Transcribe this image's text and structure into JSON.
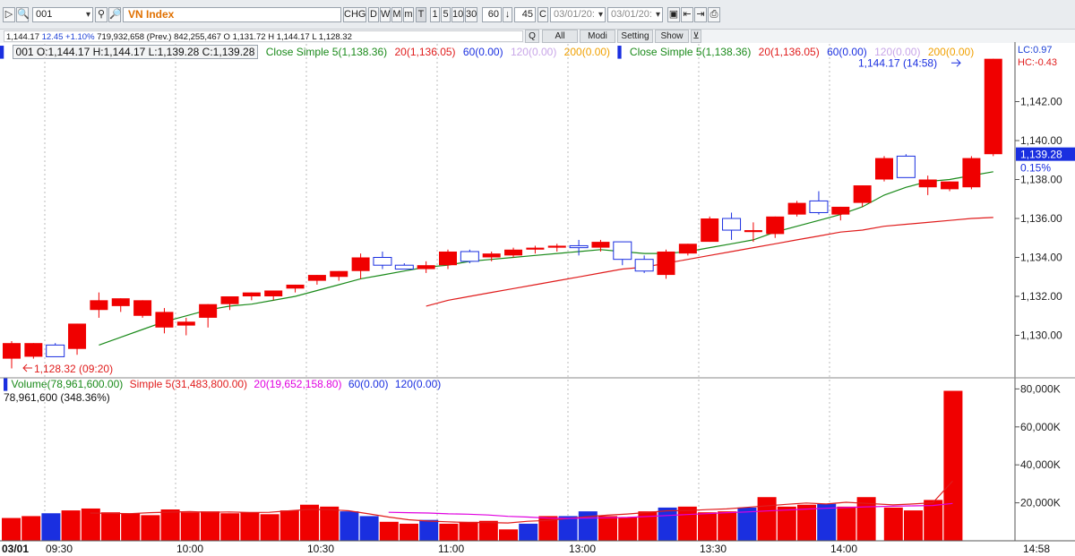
{
  "toolbar": {
    "code_value": "001",
    "index_name": "VN Index",
    "buttons": [
      "CHG",
      "D",
      "W",
      "M",
      "m",
      "T",
      "1",
      "5",
      "10",
      "30"
    ],
    "interval_value": "60",
    "step_value": "45",
    "c_label": "C",
    "date_from": "03/01/20:",
    "date_to": "03/01/20:"
  },
  "infobar": {
    "price": "1,144.17",
    "change": "12.45",
    "change_pct": "+1.10%",
    "rest": "719,932,658 (Prev.) 842,255,467 O 1,131.72 H 1,144.17 L 1,128.32",
    "q_label": "Q",
    "all_label": "All",
    "modi_label": "Modi",
    "setting_label": "Setting",
    "show_label": "Show"
  },
  "legend": {
    "ohlc": "001 O:1,144.17 H:1,144.17 L:1,139.28 C:1,139.28",
    "ma5": "Close Simple 5(1,138.36)",
    "ma20": "20(1,136.05)",
    "ma60": "60(0.00)",
    "ma120": "120(0.00)",
    "ma200": "200(0.00)",
    "ma5_b": "Close Simple 5(1,138.36)",
    "ma20_b": "20(1,136.05)",
    "ma60_b": "60(0.00)",
    "ma120_b": "120(0.00)",
    "ma200_b": "200(0.00)",
    "lc": "LC:0.97",
    "hc": "HC:-0.43"
  },
  "vlegend": {
    "volume": "Volume(78,961,600.00)",
    "ma5": "Simple 5(31,483,800.00)",
    "ma20": "20(19,652,158.80)",
    "ma60": "60(0.00)",
    "ma120": "120(0.00)",
    "sub": "78,961,600 (348.36%)"
  },
  "price_axis": {
    "ticks": [
      "1,142.00",
      "1,140.00",
      "1,138.00",
      "1,136.00",
      "1,134.00",
      "1,132.00",
      "1,130.00"
    ],
    "current": "1,139.28",
    "current_pct": "0.15%"
  },
  "volume_axis": {
    "ticks": [
      "80,000K",
      "60,000K",
      "40,000K",
      "20,000K"
    ]
  },
  "time_axis": {
    "date": "03/01",
    "labels": [
      "09:30",
      "10:00",
      "10:30",
      "11:00",
      "13:00",
      "13:30",
      "14:00"
    ],
    "last": "14:58"
  },
  "annotations": {
    "high": "1,144.17 (14:58)",
    "low": "1,128.32 (09:20)"
  },
  "colors": {
    "up": "#f00000",
    "down": "#1a2fe0",
    "ma5": "#1a8a1a",
    "ma20": "#e01c1c",
    "vol_ma5": "#e01c1c",
    "vol_ma20": "#e000e0"
  },
  "chart_data": {
    "type": "candlestick",
    "price_range": [
      1128.3,
      1144.2
    ],
    "volume_range_k": [
      0,
      80000
    ],
    "candles": [
      {
        "o": 1128.8,
        "h": 1129.7,
        "l": 1128.3,
        "c": 1129.6
      },
      {
        "o": 1128.9,
        "h": 1129.6,
        "l": 1128.8,
        "c": 1129.6
      },
      {
        "o": 1129.5,
        "h": 1129.6,
        "l": 1128.9,
        "c": 1128.9
      },
      {
        "o": 1129.3,
        "h": 1130.6,
        "l": 1129.0,
        "c": 1130.6
      },
      {
        "o": 1131.3,
        "h": 1132.2,
        "l": 1130.9,
        "c": 1131.8
      },
      {
        "o": 1131.5,
        "h": 1131.9,
        "l": 1131.2,
        "c": 1131.9
      },
      {
        "o": 1131.0,
        "h": 1131.8,
        "l": 1130.9,
        "c": 1131.8
      },
      {
        "o": 1130.4,
        "h": 1131.4,
        "l": 1130.1,
        "c": 1131.2
      },
      {
        "o": 1130.5,
        "h": 1130.9,
        "l": 1130.0,
        "c": 1130.7
      },
      {
        "o": 1130.9,
        "h": 1131.6,
        "l": 1130.4,
        "c": 1131.6
      },
      {
        "o": 1131.6,
        "h": 1132.0,
        "l": 1131.3,
        "c": 1132.0
      },
      {
        "o": 1132.0,
        "h": 1132.2,
        "l": 1131.8,
        "c": 1132.2
      },
      {
        "o": 1132.0,
        "h": 1132.3,
        "l": 1131.8,
        "c": 1132.3
      },
      {
        "o": 1132.4,
        "h": 1132.6,
        "l": 1132.2,
        "c": 1132.6
      },
      {
        "o": 1132.8,
        "h": 1133.1,
        "l": 1132.6,
        "c": 1133.1
      },
      {
        "o": 1133.0,
        "h": 1133.3,
        "l": 1132.8,
        "c": 1133.3
      },
      {
        "o": 1133.3,
        "h": 1134.2,
        "l": 1132.9,
        "c": 1134.0
      },
      {
        "o": 1134.0,
        "h": 1134.3,
        "l": 1133.4,
        "c": 1133.6
      },
      {
        "o": 1133.6,
        "h": 1133.7,
        "l": 1133.4,
        "c": 1133.4
      },
      {
        "o": 1133.4,
        "h": 1133.8,
        "l": 1133.2,
        "c": 1133.6
      },
      {
        "o": 1133.6,
        "h": 1134.4,
        "l": 1133.4,
        "c": 1134.3
      },
      {
        "o": 1134.3,
        "h": 1134.4,
        "l": 1133.7,
        "c": 1133.8
      },
      {
        "o": 1134.0,
        "h": 1134.3,
        "l": 1133.8,
        "c": 1134.2
      },
      {
        "o": 1134.1,
        "h": 1134.5,
        "l": 1134.0,
        "c": 1134.4
      },
      {
        "o": 1134.4,
        "h": 1134.6,
        "l": 1134.2,
        "c": 1134.5
      },
      {
        "o": 1134.5,
        "h": 1134.7,
        "l": 1134.3,
        "c": 1134.6
      },
      {
        "o": 1134.6,
        "h": 1134.9,
        "l": 1134.1,
        "c": 1134.5
      },
      {
        "o": 1134.5,
        "h": 1134.9,
        "l": 1134.3,
        "c": 1134.8
      },
      {
        "o": 1134.8,
        "h": 1134.8,
        "l": 1133.6,
        "c": 1133.9
      },
      {
        "o": 1133.9,
        "h": 1134.1,
        "l": 1133.2,
        "c": 1133.3
      },
      {
        "o": 1133.1,
        "h": 1134.4,
        "l": 1132.9,
        "c": 1134.3
      },
      {
        "o": 1134.2,
        "h": 1134.7,
        "l": 1134.1,
        "c": 1134.7
      },
      {
        "o": 1134.8,
        "h": 1136.1,
        "l": 1134.8,
        "c": 1136.0
      },
      {
        "o": 1136.0,
        "h": 1136.3,
        "l": 1134.9,
        "c": 1135.4
      },
      {
        "o": 1135.3,
        "h": 1135.8,
        "l": 1134.8,
        "c": 1135.4
      },
      {
        "o": 1135.2,
        "h": 1136.1,
        "l": 1135.0,
        "c": 1136.1
      },
      {
        "o": 1136.2,
        "h": 1136.9,
        "l": 1136.1,
        "c": 1136.8
      },
      {
        "o": 1136.9,
        "h": 1137.4,
        "l": 1136.2,
        "c": 1136.3
      },
      {
        "o": 1136.2,
        "h": 1136.6,
        "l": 1135.9,
        "c": 1136.6
      },
      {
        "o": 1136.8,
        "h": 1137.7,
        "l": 1136.6,
        "c": 1137.7
      },
      {
        "o": 1138.0,
        "h": 1139.2,
        "l": 1137.9,
        "c": 1139.1
      },
      {
        "o": 1139.2,
        "h": 1139.3,
        "l": 1138.1,
        "c": 1138.1
      },
      {
        "o": 1137.6,
        "h": 1138.2,
        "l": 1137.2,
        "c": 1138.0
      },
      {
        "o": 1137.5,
        "h": 1137.9,
        "l": 1137.4,
        "c": 1137.9
      },
      {
        "o": 1137.6,
        "h": 1139.2,
        "l": 1137.5,
        "c": 1139.1
      },
      {
        "o": 1139.3,
        "h": 1144.2,
        "l": 1139.2,
        "c": 1144.2
      }
    ],
    "ma5": [
      null,
      null,
      null,
      null,
      1129.5,
      1129.9,
      1130.3,
      1130.7,
      1131.0,
      1131.3,
      1131.5,
      1131.6,
      1131.8,
      1132.0,
      1132.3,
      1132.6,
      1132.9,
      1133.1,
      1133.3,
      1133.5,
      1133.6,
      1133.8,
      1133.9,
      1134.0,
      1134.1,
      1134.2,
      1134.3,
      1134.4,
      1134.3,
      1134.2,
      1134.2,
      1134.3,
      1134.5,
      1134.7,
      1134.9,
      1135.3,
      1135.6,
      1135.9,
      1136.2,
      1136.6,
      1137.2,
      1137.6,
      1137.9,
      1138.0,
      1138.2,
      1138.4
    ],
    "ma20": [
      null,
      null,
      null,
      null,
      null,
      null,
      null,
      null,
      null,
      null,
      null,
      null,
      null,
      null,
      null,
      null,
      null,
      null,
      null,
      1131.5,
      1131.8,
      1132.0,
      1132.2,
      1132.4,
      1132.6,
      1132.8,
      1133.0,
      1133.2,
      1133.4,
      1133.5,
      1133.7,
      1133.9,
      1134.1,
      1134.3,
      1134.5,
      1134.7,
      1134.9,
      1135.1,
      1135.3,
      1135.4,
      1135.6,
      1135.7,
      1135.8,
      1135.9,
      1136.0,
      1136.05
    ],
    "volume_k": [
      12000,
      13000,
      14500,
      16000,
      17000,
      15000,
      14500,
      13500,
      16500,
      15000,
      15500,
      14500,
      15000,
      14000,
      16000,
      19000,
      18000,
      15500,
      13000,
      10000,
      9000,
      11000,
      9000,
      10000,
      10500,
      6000,
      9000,
      13000,
      13000,
      15500,
      13000,
      12500,
      15500,
      17500,
      18000,
      15000,
      15500,
      17500,
      23000,
      18000,
      19000,
      19500,
      18000,
      23000,
      17500,
      16000,
      21500,
      79000
    ],
    "vol_ma5": [
      null,
      null,
      null,
      null,
      14600,
      14500,
      14300,
      14800,
      15100,
      15400,
      15000,
      15200,
      14900,
      15000,
      15800,
      16500,
      16400,
      15800,
      14200,
      12500,
      11100,
      10400,
      10000,
      9600,
      9600,
      9400,
      10300,
      10700,
      11700,
      12700,
      13500,
      14100,
      14900,
      15800,
      15900,
      16400,
      16800,
      17600,
      18400,
      19200,
      19900,
      19400,
      20300,
      19700,
      18900,
      19400,
      20000,
      31484
    ],
    "vol_ma20": [
      null,
      null,
      null,
      null,
      null,
      null,
      null,
      null,
      null,
      null,
      null,
      null,
      null,
      null,
      null,
      null,
      null,
      null,
      null,
      15000,
      14800,
      14600,
      14200,
      14000,
      13600,
      12900,
      12500,
      12000,
      11800,
      12000,
      12100,
      12300,
      12800,
      13300,
      13800,
      14300,
      14800,
      15200,
      15700,
      16200,
      16700,
      17100,
      17500,
      17900,
      18200,
      18400,
      18600,
      19652
    ]
  }
}
